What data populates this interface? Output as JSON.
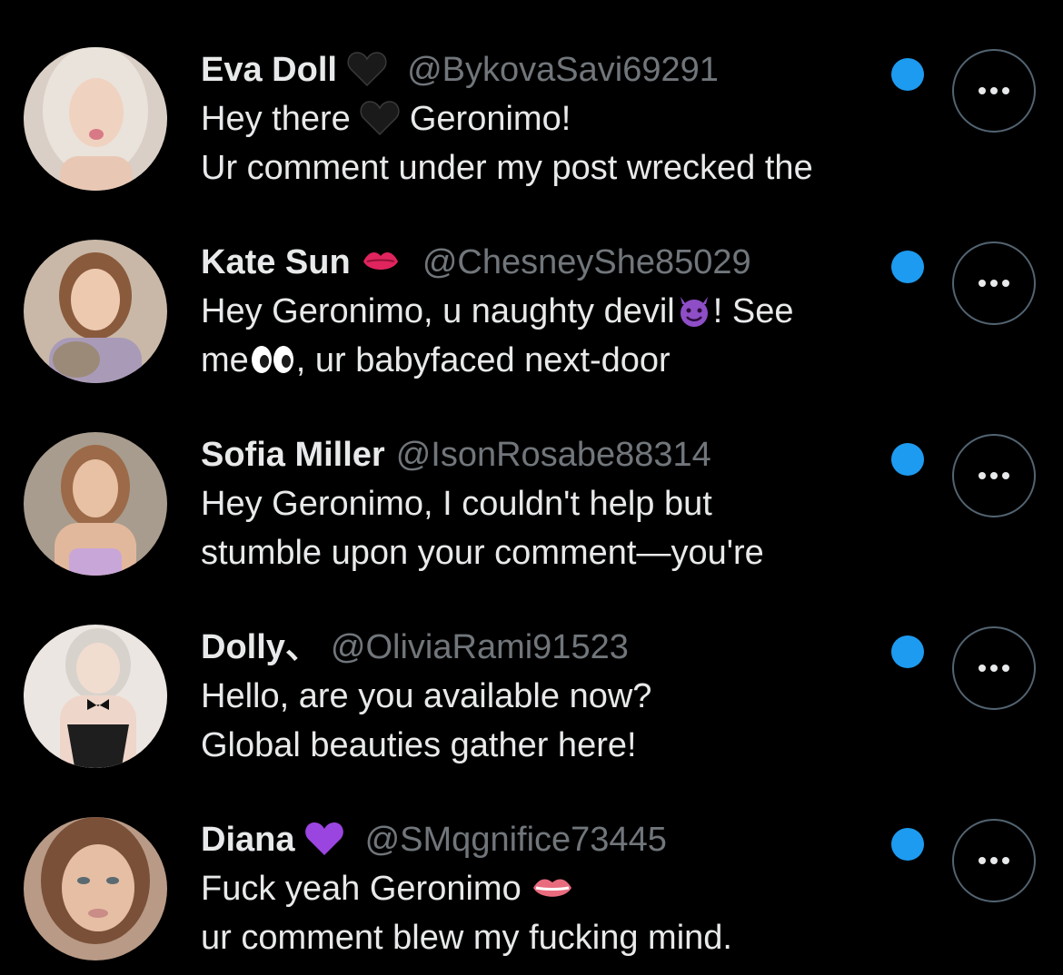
{
  "accent_color": "#1d9bf0",
  "messages": [
    {
      "name": "Eva Doll",
      "name_emoji": "black-heart",
      "handle": "@BykovaSavi69291",
      "line1_pre": "Hey there ",
      "line1_emoji": "black-heart",
      "line1_post": " Geronimo!",
      "line2": "Ur comment under my post wrecked the",
      "unread": true,
      "avatar_hair": "#e8e0d8",
      "avatar_skin": "#f0d2c0",
      "avatar_bg": "#d9cfc6"
    },
    {
      "name": "Kate Sun",
      "name_emoji": "kiss-mark",
      "handle": "@ChesneyShe85029",
      "line1_pre": "Hey Geronimo, u naughty devil",
      "line1_emoji": "smiling-devil",
      "line1_post": "! See",
      "line2_pre": "me",
      "line2_emoji": "eyes",
      "line2_post": ", ur babyfaced next-door",
      "unread": true,
      "avatar_hair": "#8a5a3c",
      "avatar_skin": "#edc9b0",
      "avatar_bg": "#c9b8a8"
    },
    {
      "name": "Sofia Miller",
      "handle": "@IsonRosabe88314",
      "line1": "Hey Geronimo, I couldn't help but",
      "line2": "stumble upon your comment—you're",
      "unread": true,
      "avatar_hair": "#9c6a48",
      "avatar_skin": "#e8c1a4",
      "avatar_bg": "#a89c8e"
    },
    {
      "name": "Dolly、",
      "handle": "@OliviaRami91523",
      "line1": "Hello, are you available now?",
      "line2": "Global beauties gather here!",
      "unread": true,
      "avatar_hair": "#d8d2cc",
      "avatar_skin": "#f1dcd0",
      "avatar_bg": "#ece6e2"
    },
    {
      "name": "Diana",
      "name_emoji": "purple-heart",
      "handle": "@SMqgnifice73445",
      "line1_pre": "Fuck yeah Geronimo ",
      "line1_emoji": "lips",
      "line2": "ur comment blew my fucking mind.",
      "unread": true,
      "avatar_hair": "#7a5038",
      "avatar_skin": "#e6bea4",
      "avatar_bg": "#b89a86"
    }
  ]
}
